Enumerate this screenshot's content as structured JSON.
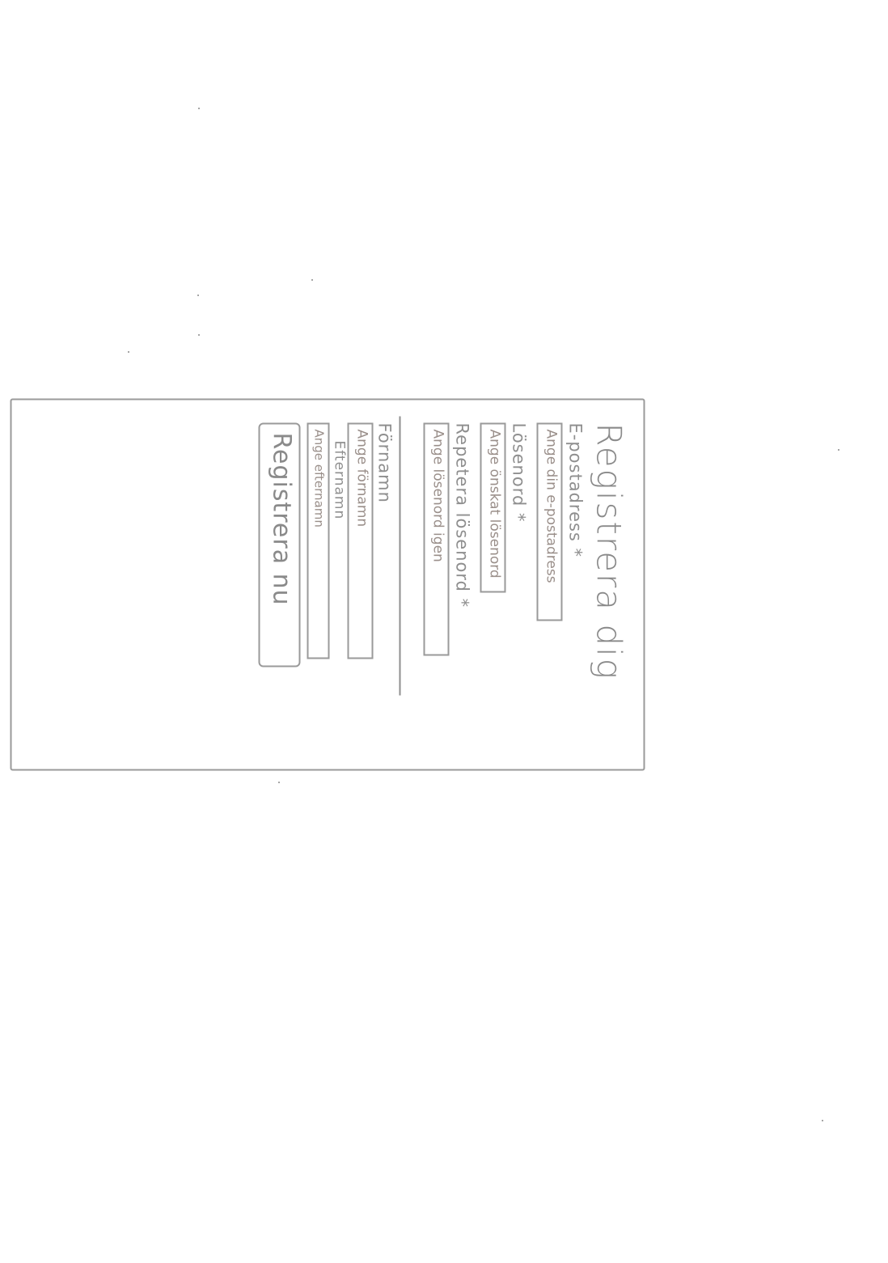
{
  "form": {
    "title": "Registrera dig",
    "email": {
      "label": "E-postadress *",
      "placeholder": "Ange din e-postadress"
    },
    "password": {
      "label": "Lösenord *",
      "placeholder": "Ange önskat lösenord"
    },
    "repeat_password": {
      "label": "Repetera lösenord *",
      "placeholder": "Ange lösenord igen"
    },
    "first_name": {
      "label": "Förnamn",
      "placeholder": "Ange förnamn"
    },
    "last_name": {
      "label": "Efternamn",
      "placeholder": "Ange efternamn"
    },
    "submit_label": "Registrera nu"
  }
}
